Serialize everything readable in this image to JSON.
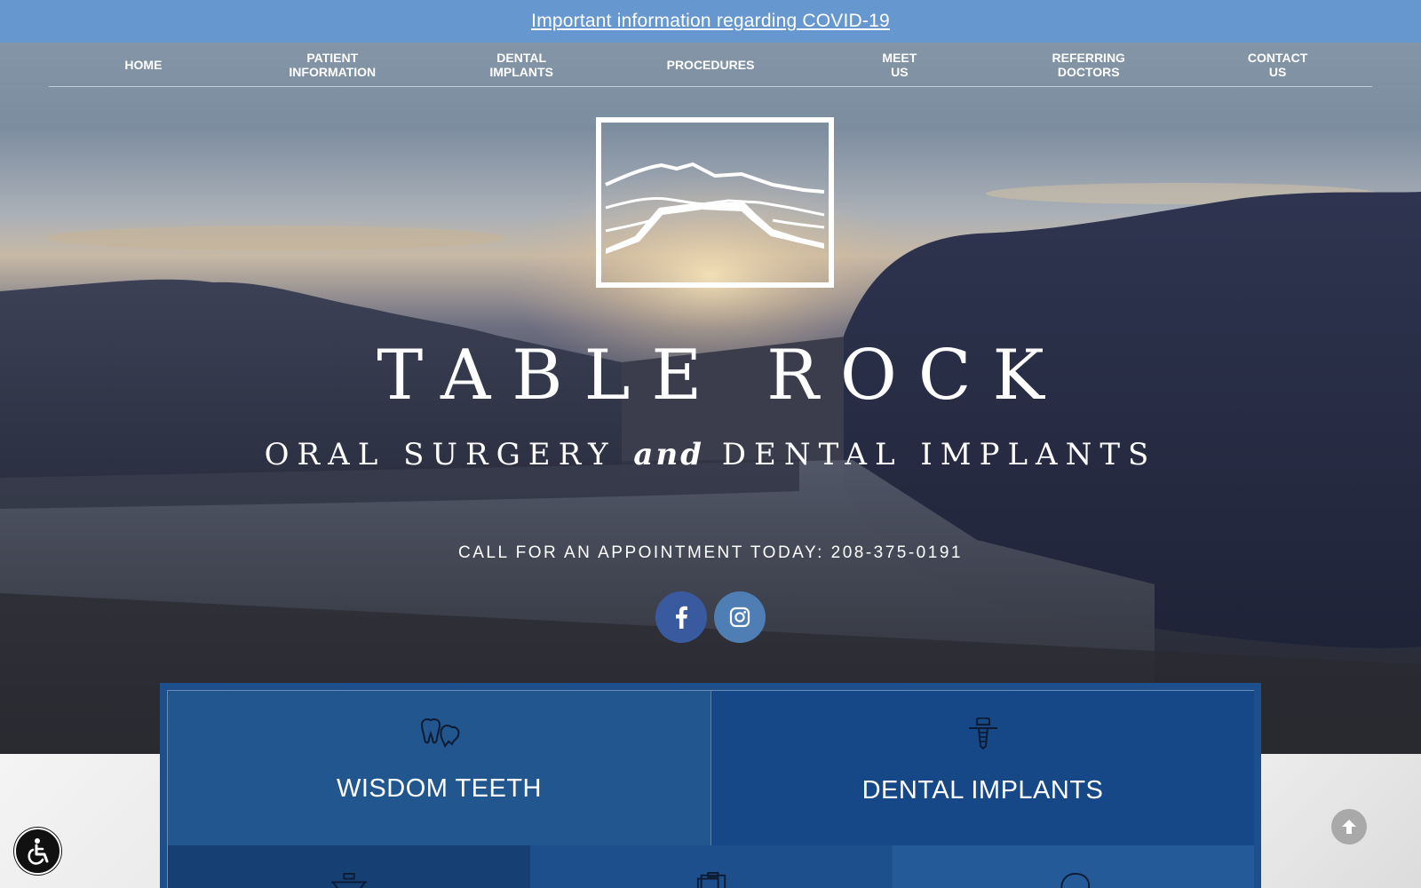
{
  "banner": {
    "link_text": "Important information regarding COVID-19"
  },
  "nav": {
    "items": [
      {
        "label": "HOME"
      },
      {
        "label": "PATIENT\nINFORMATION"
      },
      {
        "label": "DENTAL\nIMPLANTS"
      },
      {
        "label": "PROCEDURES"
      },
      {
        "label": "MEET\nUS"
      },
      {
        "label": "REFERRING\nDOCTORS"
      },
      {
        "label": "CONTACT\nUS"
      }
    ]
  },
  "hero": {
    "title": "TABLE ROCK",
    "subtitle_part1": "ORAL SURGERY",
    "subtitle_and": "and",
    "subtitle_part2": "DENTAL IMPLANTS",
    "call_text": "CALL FOR AN APPOINTMENT TODAY: 208-375-0191",
    "social": [
      {
        "icon": "facebook-icon"
      },
      {
        "icon": "instagram-icon"
      }
    ]
  },
  "services": {
    "tiles": [
      {
        "label": "WISDOM TEETH",
        "icon": "wisdom-teeth-icon"
      },
      {
        "label": "DENTAL IMPLANTS",
        "icon": "dental-implant-icon"
      },
      {
        "label": "",
        "icon": "implant-bridge-icon"
      },
      {
        "label": "",
        "icon": "clipboard-icon"
      },
      {
        "label": "",
        "icon": "head-profile-icon"
      }
    ]
  },
  "widgets": {
    "accessibility_icon": "wheelchair-icon",
    "scroll_top_icon": "arrow-up-icon"
  },
  "colors": {
    "banner_bg": "#6698cf",
    "services_bg": "#1c4f8c",
    "facebook": "#3a5aa0",
    "instagram": "#4f7eb5"
  }
}
